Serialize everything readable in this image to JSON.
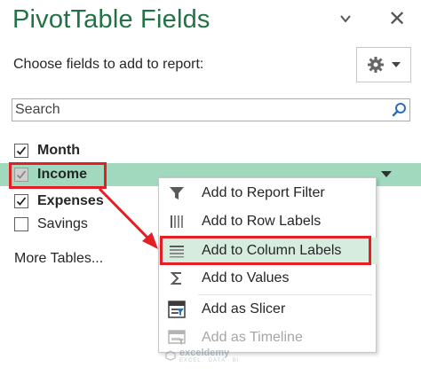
{
  "pane": {
    "title": "PivotTable Fields",
    "subtitle": "Choose fields to add to report:",
    "dropdown_icon": "chevron-down-icon",
    "close_icon": "close-icon",
    "close_glyph": "✕"
  },
  "search": {
    "placeholder": "Search",
    "icon": "search-icon"
  },
  "fields": [
    {
      "label": "Month",
      "checked": true,
      "bold": true
    },
    {
      "label": "Income",
      "checked": true,
      "bold": true,
      "highlighted": true
    },
    {
      "label": "Expenses",
      "checked": true,
      "bold": true
    },
    {
      "label": "Savings",
      "checked": false,
      "bold": false
    }
  ],
  "more_tables": "More Tables...",
  "context_menu": {
    "items": [
      {
        "label": "Add to Report Filter",
        "icon": "filter-icon"
      },
      {
        "label": "Add to Row Labels",
        "icon": "row-labels-icon"
      },
      {
        "label": "Add to Column Labels",
        "icon": "column-labels-icon",
        "active": true
      },
      {
        "label": "Add to Values",
        "icon": "sigma-icon"
      },
      {
        "label": "Add as Slicer",
        "icon": "slicer-icon"
      },
      {
        "label": "Add as Timeline",
        "icon": "timeline-icon",
        "disabled": true
      }
    ]
  },
  "colors": {
    "title_green": "#217346",
    "highlight_row": "#a0d9bd",
    "menu_active": "#d6ecde",
    "annotation_red": "#e31e24"
  },
  "watermark": {
    "name": "exceldemy",
    "tagline": "EXCEL · DATA · BI"
  }
}
